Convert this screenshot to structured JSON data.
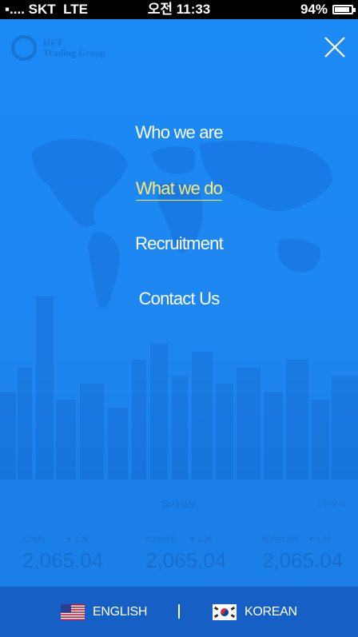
{
  "status_bar": {
    "carrier": "SKT",
    "network": "LTE",
    "time": "오전 11:33",
    "battery": "94%",
    "battery_level": 0.94
  },
  "header": {
    "logo_line1": "HFT",
    "logo_line2": "Trading Group"
  },
  "menu": {
    "items": [
      {
        "label": "Who we are"
      },
      {
        "label": "What we do",
        "active": true
      },
      {
        "label": "Recruitment"
      },
      {
        "label": "Contact Us"
      }
    ]
  },
  "market": {
    "title": "증시정보",
    "more": "+ 더보기",
    "indices": [
      {
        "name": "KOSPI",
        "change": "▼ 1.26",
        "value": "2,065.04"
      },
      {
        "name": "KOSDAQ",
        "change": "▼ 1.26",
        "value": "2,065.04"
      },
      {
        "name": "KOSPI 200",
        "change": "▼ 1.26",
        "value": "2,065.04"
      }
    ]
  },
  "language": {
    "english": "ENGLISH",
    "korean": "KOREAN"
  },
  "colors": {
    "background": "#1e88f3",
    "active_menu": "#ffe96a",
    "language_bar": "#165fc4"
  },
  "icons": [
    "close-icon",
    "us-flag-icon",
    "kr-flag-icon",
    "battery-icon",
    "signal-icon"
  ]
}
